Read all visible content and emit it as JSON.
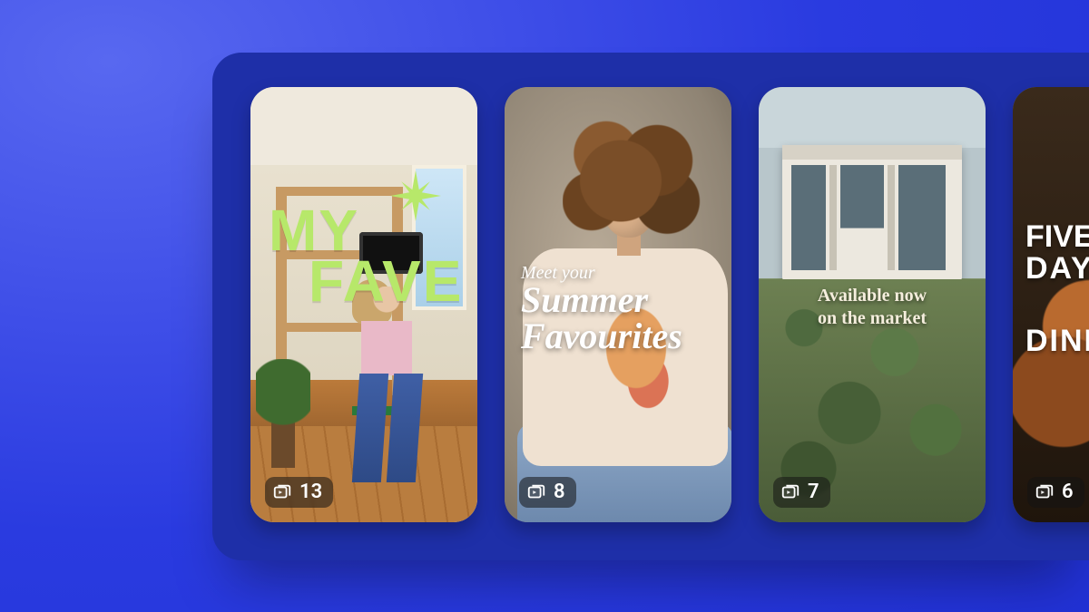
{
  "cards": [
    {
      "overlay_line1": "MY",
      "overlay_line2": "FAVE",
      "count": "13"
    },
    {
      "kicker": "Meet your",
      "overlay_line1": "Summer",
      "overlay_line2": "Favourites",
      "count": "8"
    },
    {
      "overlay_line1": "Available now",
      "overlay_line2": "on the market",
      "count": "7"
    },
    {
      "overlay_line1": "FIVE",
      "overlay_line2": "DAYS",
      "overlay_line3": "DINE",
      "count": "6"
    }
  ],
  "icon_names": {
    "badge": "video-stack-icon",
    "star": "sparkle-icon"
  }
}
